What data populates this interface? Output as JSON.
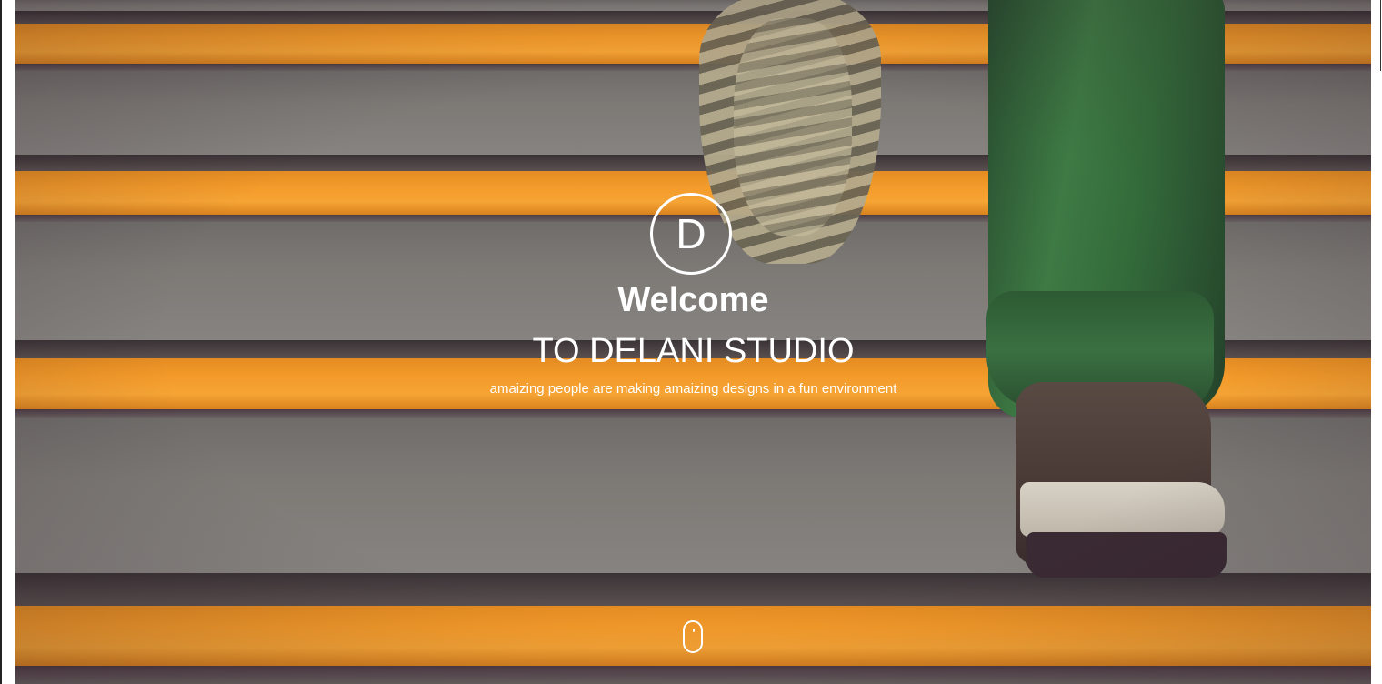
{
  "hero": {
    "logo_letter": "D",
    "welcome": "Welcome",
    "studio_title": "TO DELANI STUDIO",
    "tagline": "amaizing people are making amaizing designs in a fun environment",
    "background": "stairs-photo",
    "scroll_indicator_icon": "mouse-scroll-icon"
  },
  "colors": {
    "text": "#ffffff",
    "stripe_orange": "#f39a2a",
    "step_gray": "#7d7a76"
  }
}
